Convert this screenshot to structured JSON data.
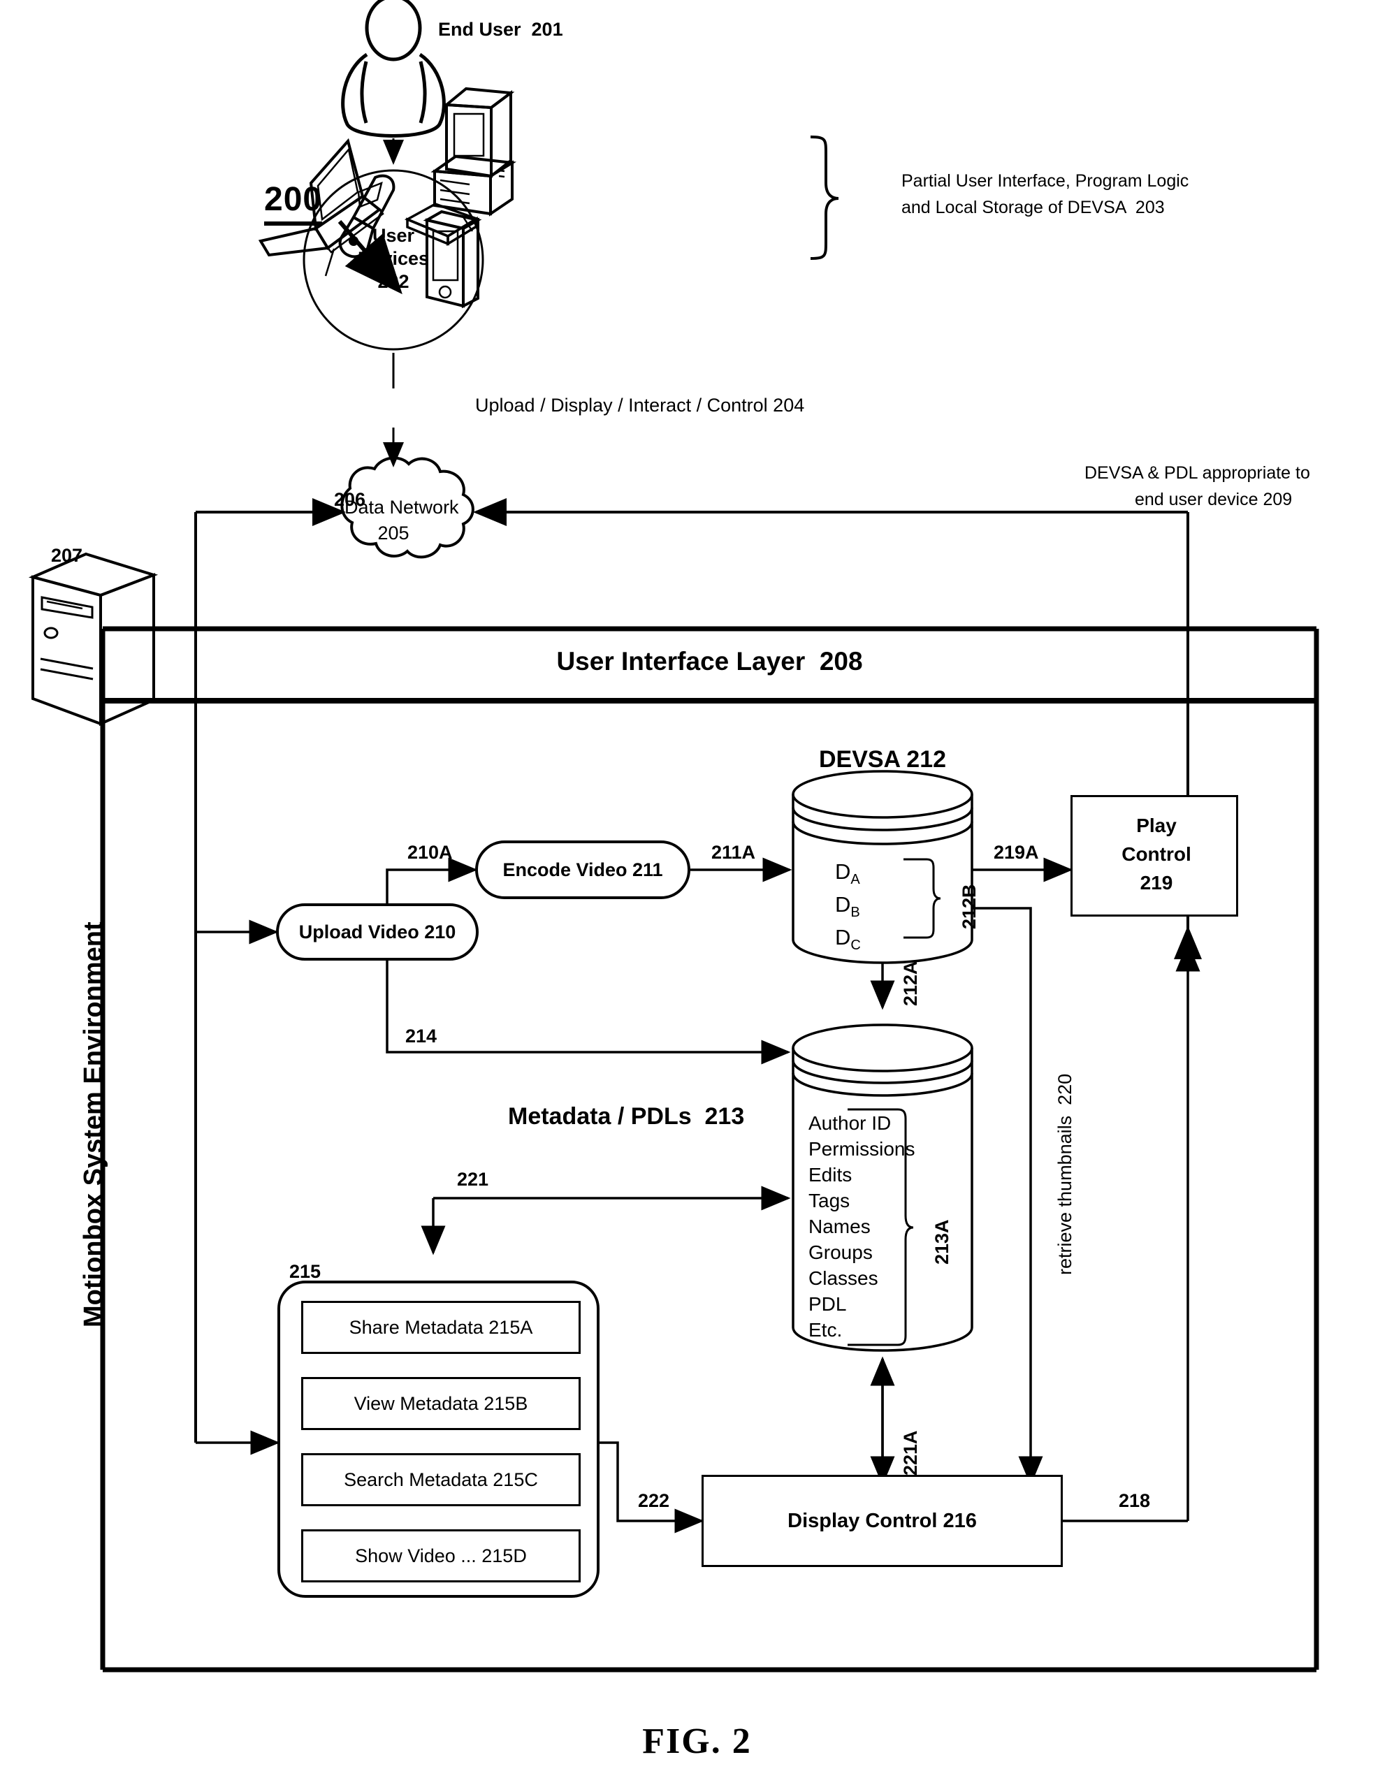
{
  "figure": {
    "number_label": "200",
    "caption": "FIG. 2"
  },
  "top": {
    "end_user": "End User  201",
    "user_devices": "User\nDevices\n202",
    "user_devices_line1": "User",
    "user_devices_line2": "Devices",
    "user_devices_line3": "202",
    "bracket_note_line1": "Partial User Interface, Program Logic",
    "bracket_note_line2": "and Local Storage of DEVSA  203",
    "upload_display": "Upload / Display / Interact / Control 204",
    "data_network_line1": "Data Network",
    "data_network_line2": "205",
    "link_206": "206",
    "devsa_pdl_line1": "DEVSA & PDL appropriate to",
    "devsa_pdl_line2": "end user device 209"
  },
  "system": {
    "server_label": "207",
    "environment_title": "Motionbox System Environment",
    "ui_layer": "User Interface Layer  208"
  },
  "flow": {
    "upload_video": "Upload Video 210",
    "encode_video": "Encode Video 211",
    "label_210A": "210A",
    "label_211A": "211A",
    "label_214": "214",
    "label_219A": "219A",
    "label_212A": "212A",
    "label_221": "221",
    "label_221A": "221A",
    "label_222": "222",
    "label_218": "218",
    "label_220": "retrieve thumbnails  220"
  },
  "devsa_store": {
    "title": "DEVSA 212",
    "items": [
      "D",
      "D",
      "D"
    ],
    "item_labels": [
      {
        "base": "D",
        "sub": "A"
      },
      {
        "base": "D",
        "sub": "B"
      },
      {
        "base": "D",
        "sub": "C"
      }
    ],
    "brace_label": "212B"
  },
  "metadata_store": {
    "title": "Metadata / PDLs  213",
    "items": [
      "Author ID",
      "Permissions",
      "Edits",
      "Tags",
      "Names",
      "Groups",
      "Classes",
      "PDL",
      "Etc."
    ],
    "brace_label": "213A"
  },
  "metadata_functions": {
    "group_label": "215",
    "items": [
      {
        "label": "Share Metadata 215A"
      },
      {
        "label": "View Metadata 215B"
      },
      {
        "label": "Search Metadata 215C"
      },
      {
        "label": "Show Video ... 215D"
      }
    ]
  },
  "controls": {
    "play_control_line1": "Play",
    "play_control_line2": "Control",
    "play_control_line3": "219",
    "display_control": "Display Control 216"
  },
  "colors": {
    "ink": "#000000",
    "paper": "#ffffff"
  }
}
